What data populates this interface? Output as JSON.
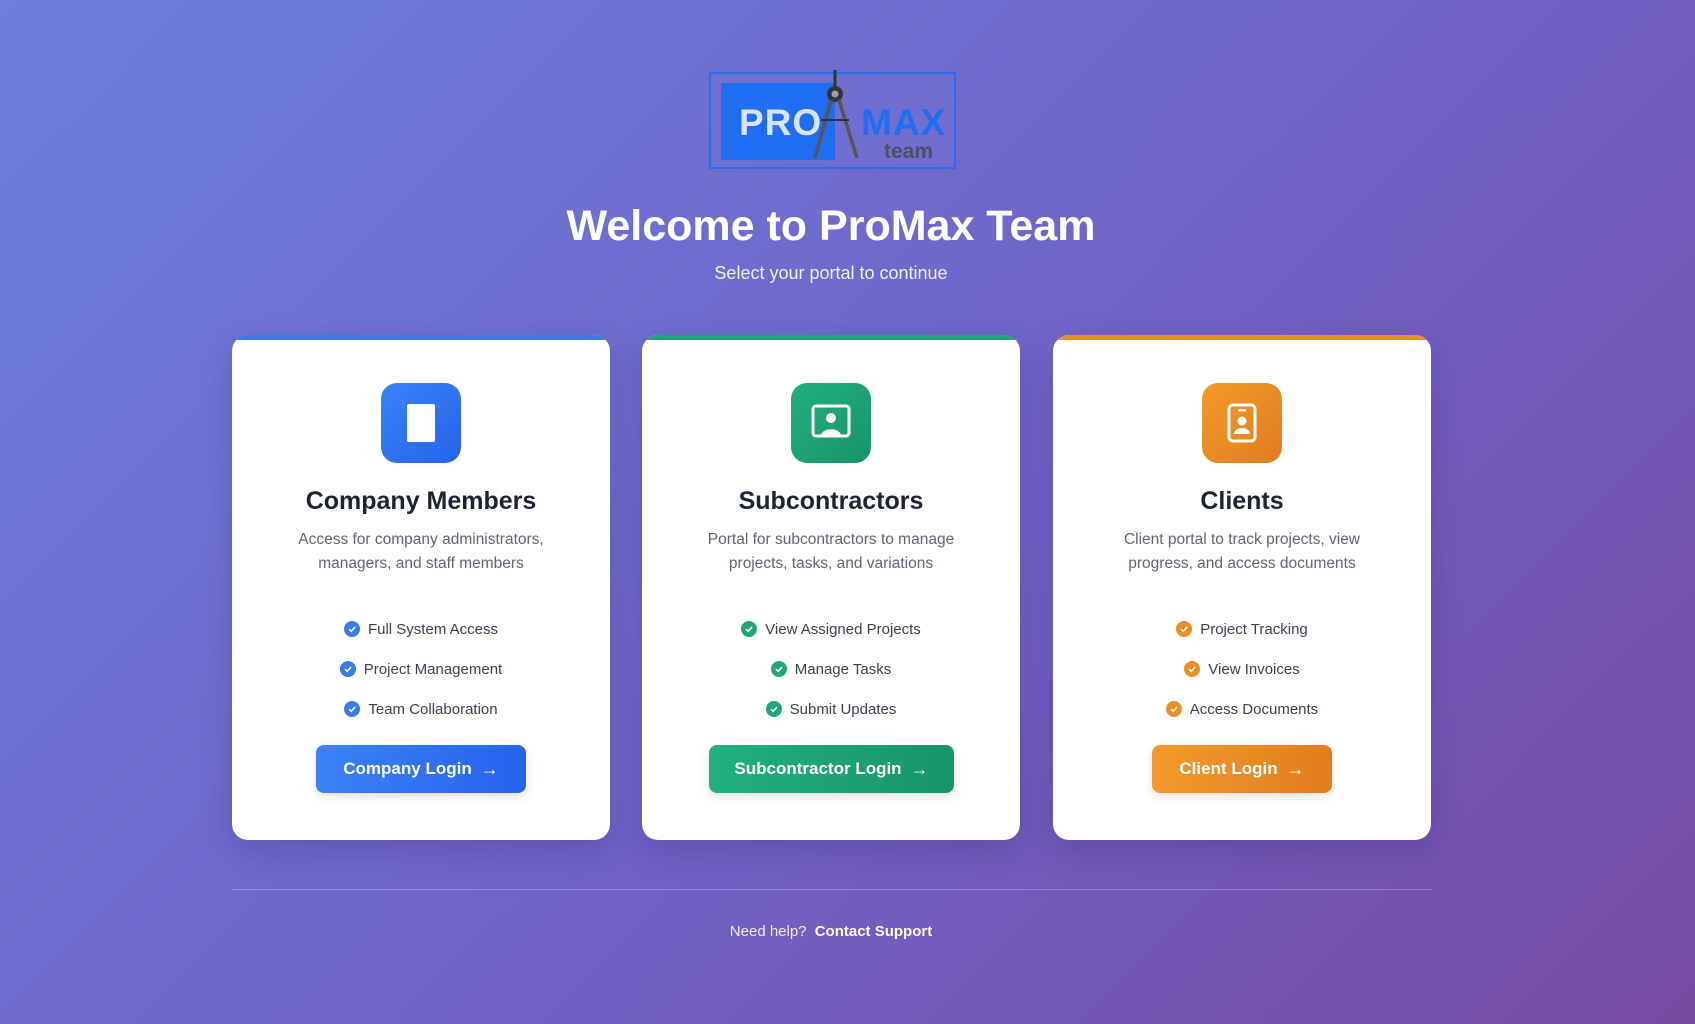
{
  "logo": {
    "text_main": "PRO",
    "text_max": "MAX",
    "text_team": "team"
  },
  "header": {
    "title": "Welcome to ProMax Team",
    "subtitle": "Select your portal to continue"
  },
  "cards": [
    {
      "title": "Company Members",
      "description": "Access for company administrators, managers, and staff members",
      "features": [
        "Full System Access",
        "Project Management",
        "Team Collaboration"
      ],
      "button_label": "Company Login",
      "icon": "building-icon",
      "accent": "#3b7be8"
    },
    {
      "title": "Subcontractors",
      "description": "Portal for subcontractors to manage projects, tasks, and variations",
      "features": [
        "View Assigned Projects",
        "Manage Tasks",
        "Submit Updates"
      ],
      "button_label": "Subcontractor Login",
      "icon": "user-square-icon",
      "accent": "#1fa779"
    },
    {
      "title": "Clients",
      "description": "Client portal to track projects, view progress, and access documents",
      "features": [
        "Project Tracking",
        "View Invoices",
        "Access Documents"
      ],
      "button_label": "Client Login",
      "icon": "id-badge-icon",
      "accent": "#ec8f26"
    }
  ],
  "footer": {
    "text": "Need help?",
    "link": "Contact Support"
  },
  "colors": {
    "bg_start": "#6b7fdd",
    "bg_end": "#764ba2",
    "blue": "#3b7be8",
    "green": "#1fa779",
    "orange": "#ec8f26"
  }
}
